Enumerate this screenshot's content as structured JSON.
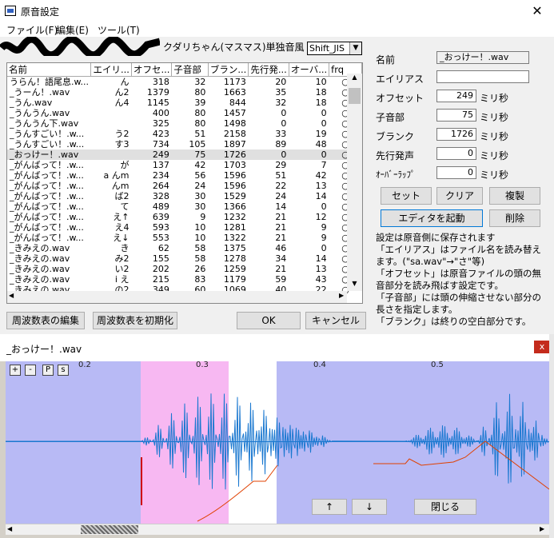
{
  "window": {
    "title": "原音設定",
    "close": "✕"
  },
  "menu": {
    "file": "ファイル(F)",
    "edit": "編集(E)",
    "tools": "ツール(T)"
  },
  "project_title": "クダリちゃん(マスマス)単独音風",
  "encoding": {
    "selected": "Shift_JIS"
  },
  "table": {
    "headers": [
      "名前",
      "エイリ...",
      "オフセ...",
      "子音部",
      "ブラン...",
      "先行発...",
      "オーバ...",
      "frq"
    ],
    "rows": [
      [
        "うらん！語尾息.w...",
        "ん",
        "318",
        "32",
        "1173",
        "20",
        "10",
        "○"
      ],
      [
        "_うーん！.wav",
        "ん2",
        "1379",
        "80",
        "1663",
        "35",
        "18",
        "○"
      ],
      [
        "_うん.wav",
        "ん4",
        "1145",
        "39",
        "844",
        "32",
        "18",
        "○"
      ],
      [
        "_うんうん.wav",
        "",
        "400",
        "80",
        "1457",
        "0",
        "0",
        "○"
      ],
      [
        "_うんうん下.wav",
        "",
        "325",
        "80",
        "1498",
        "0",
        "0",
        "○"
      ],
      [
        "_うんすごい！.w...",
        "う2",
        "423",
        "51",
        "2158",
        "33",
        "19",
        "○"
      ],
      [
        "_うんすごい！.w...",
        "す3",
        "734",
        "105",
        "1897",
        "89",
        "48",
        "○"
      ],
      [
        "_おっけー！.wav",
        "",
        "249",
        "75",
        "1726",
        "0",
        "0",
        "○"
      ],
      [
        "_がんばって！.w...",
        "が",
        "137",
        "42",
        "1703",
        "29",
        "7",
        "○"
      ],
      [
        "_がんばって！.w...",
        "a んm",
        "234",
        "56",
        "1596",
        "51",
        "42",
        "○"
      ],
      [
        "_がんばって！.w...",
        "んm",
        "264",
        "24",
        "1596",
        "22",
        "13",
        "○"
      ],
      [
        "_がんばって！.w...",
        "ば2",
        "328",
        "30",
        "1529",
        "24",
        "14",
        "○"
      ],
      [
        "_がんばって！.w...",
        "て",
        "489",
        "30",
        "1366",
        "14",
        "0",
        "○"
      ],
      [
        "_がんばって！.w...",
        "え↑",
        "639",
        "9",
        "1232",
        "21",
        "12",
        "○"
      ],
      [
        "_がんばって！.w...",
        "え4",
        "593",
        "10",
        "1281",
        "21",
        "9",
        "○"
      ],
      [
        "_がんばって！.w...",
        "え↓",
        "553",
        "10",
        "1322",
        "21",
        "9",
        "○"
      ],
      [
        "_きみえの.wav",
        "き",
        "62",
        "58",
        "1375",
        "46",
        "0",
        "○"
      ],
      [
        "_きみえの.wav",
        "み2",
        "155",
        "58",
        "1278",
        "34",
        "14",
        "○"
      ],
      [
        "_きみえの.wav",
        "い2",
        "202",
        "26",
        "1259",
        "21",
        "13",
        "○"
      ],
      [
        "_きみえの.wav",
        "i え",
        "215",
        "83",
        "1179",
        "59",
        "43",
        "○"
      ],
      [
        "_きみえの.wav",
        "の2",
        "349",
        "60",
        "1069",
        "40",
        "22",
        "○"
      ]
    ]
  },
  "fields": {
    "name_label": "名前",
    "name_value": "_おっけー！.wav",
    "alias_label": "エイリアス",
    "alias_value": "",
    "offset_label": "オフセット",
    "offset_value": "249",
    "consonant_label": "子音部",
    "consonant_value": "75",
    "blank_label": "ブランク",
    "blank_value": "1726",
    "preutter_label": "先行発声",
    "preutter_value": "0",
    "overlap_label": "ｵｰﾊﾞｰﾗｯﾌﾟ",
    "overlap_value": "0",
    "unit": "ミリ秒"
  },
  "buttons": {
    "set": "セット",
    "clear": "クリア",
    "duplicate": "複製",
    "launch_editor": "エディタを起動",
    "delete": "削除",
    "edit_freq": "周波数表の編集",
    "init_freq": "周波数表を初期化",
    "ok": "OK",
    "cancel": "キャンセル",
    "up": "↑",
    "down": "↓",
    "close": "閉じる"
  },
  "info": [
    "設定は原音側に保存されます",
    "「エイリアス」はファイル名を読み替えます。(\"sa.wav\"→\"さ\"等)",
    "「オフセット」は原音ファイルの頭の無音部分を読み飛ばす設定です。",
    "「子音部」には頭の伸縮させない部分の長さを指定します。",
    "「ブランク」は終りの空白部分です。"
  ],
  "wave": {
    "title": "_おっけー！.wav",
    "close": "x",
    "zoom": [
      "+",
      "-",
      "P",
      "s"
    ],
    "ticks": [
      "0.2",
      "0.3",
      "0.4",
      "0.5"
    ]
  }
}
